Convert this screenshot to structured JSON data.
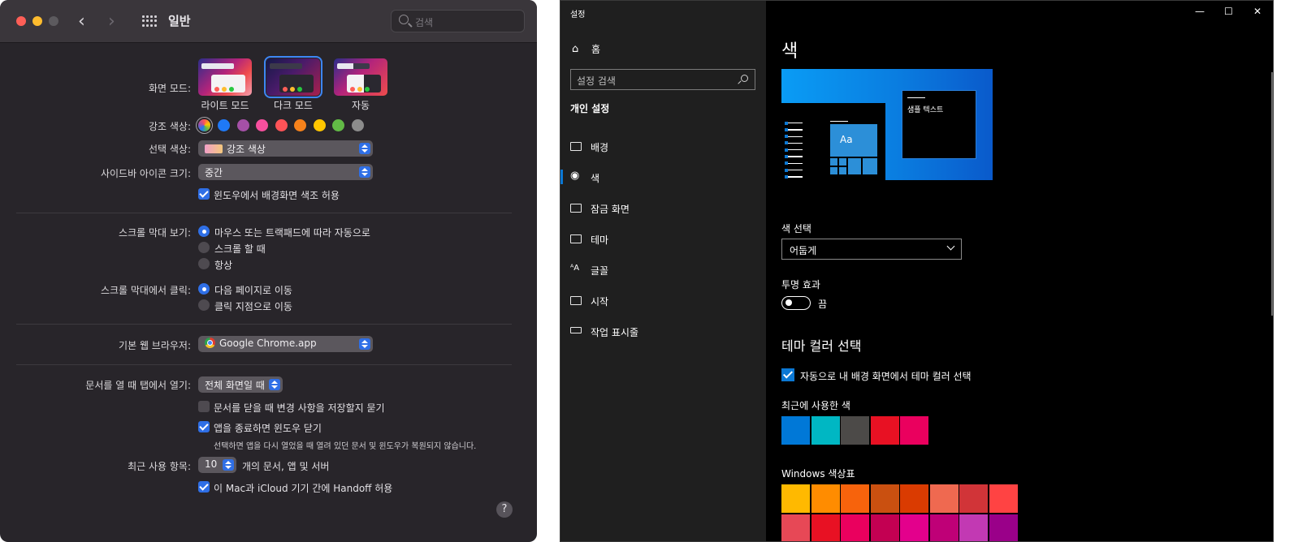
{
  "mac": {
    "title": "일반",
    "search_placeholder": "검색",
    "appearance": {
      "label": "화면 모드:",
      "options": [
        "라이트 모드",
        "다크 모드",
        "자동"
      ],
      "selected": "다크 모드"
    },
    "accent": {
      "label": "강조 색상:",
      "colors": [
        "#1f79f6",
        "#a550a7",
        "#f74f9e",
        "#fe5357",
        "#f7821b",
        "#ffc600",
        "#62ba46",
        "#8c8c8c"
      ]
    },
    "highlight": {
      "label": "선택 색상:",
      "value": "강조 색상"
    },
    "sidebar_icon": {
      "label": "사이드바 아이콘 크기:",
      "value": "중간"
    },
    "wallpaper_tint": {
      "label": "윈도우에서 배경화면 색조 허용",
      "checked": true
    },
    "scrollbars": {
      "label": "스크롤 막대 보기:",
      "options": [
        "마우스 또는 트랙패드에 따라 자동으로",
        "스크롤 할 때",
        "항상"
      ],
      "selected": 0
    },
    "scroll_click": {
      "label": "스크롤 막대에서 클릭:",
      "options": [
        "다음 페이지로 이동",
        "클릭 지점으로 이동"
      ],
      "selected": 0
    },
    "browser": {
      "label": "기본 웹 브라우저:",
      "value": "Google Chrome.app"
    },
    "tabs": {
      "label": "문서를 열 때 탭에서 열기:",
      "value": "전체 화면일 때"
    },
    "ask_save": {
      "label": "문서를 닫을 때 변경 사항을 저장할지 묻기",
      "checked": false
    },
    "close_windows": {
      "label": "앱을 종료하면 윈도우 닫기",
      "checked": true,
      "note": "선택하면 앱을 다시 열었을 때 열려 있던 문서 및 윈도우가 복원되지 않습니다."
    },
    "recent": {
      "label": "최근 사용 항목:",
      "value": "10",
      "suffix": "개의 문서, 앱 및 서버"
    },
    "handoff": {
      "label": "이 Mac과 iCloud 기기 간에 Handoff 허용",
      "checked": true
    },
    "help": "?"
  },
  "win": {
    "window_title": "설정",
    "controls": [
      "—",
      "☐",
      "✕"
    ],
    "home": "홈",
    "search_placeholder": "설정 검색",
    "section": "개인 설정",
    "nav": [
      "배경",
      "색",
      "잠금 화면",
      "테마",
      "글꼴",
      "시작",
      "작업 표시줄"
    ],
    "selected_nav": "색",
    "page_title": "색",
    "preview_text": "샘플 텍스트",
    "preview_tile": "Aa",
    "color_choice": {
      "label": "색 선택",
      "value": "어둡게"
    },
    "transparency": {
      "label": "투명 효과",
      "state": "끔"
    },
    "theme_color_heading": "테마 컬러 선택",
    "auto_color": {
      "label": "자동으로 내 배경 화면에서 테마 컬러 선택",
      "checked": true
    },
    "recent_colors": {
      "label": "최근에 사용한 색",
      "colors": [
        "#0078d7",
        "#00b7c3",
        "#4c4a48",
        "#e81123",
        "#ea005e"
      ]
    },
    "palette": {
      "label": "Windows 색상표",
      "row1": [
        "#ffb900",
        "#ff8c00",
        "#f7630c",
        "#ca5010",
        "#da3b01",
        "#ef6950",
        "#d13438",
        "#ff4343"
      ],
      "row2": [
        "#e74856",
        "#e81123",
        "#ea005e",
        "#c30052",
        "#e3008c",
        "#bf0077",
        "#c239b3",
        "#9a0089"
      ]
    }
  }
}
